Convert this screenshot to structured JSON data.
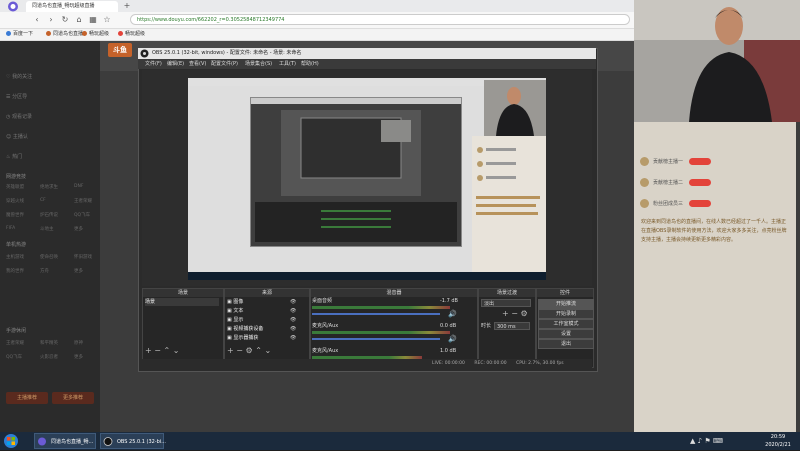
{
  "browser": {
    "tab_title": "同道鸟也直播_畅玩超级直播",
    "url": "https://www.douyu.com/662202_r=0.30525848712349774",
    "bookmarks": [
      "百度一下",
      "同道鸟也直播",
      "畅玩超级",
      "畅玩超级"
    ]
  },
  "site": {
    "logo": "斗鱼",
    "left_nav": {
      "items": [
        "我的关注",
        "分区导",
        "观看记录",
        "主播认",
        "热门"
      ],
      "sections": [
        {
          "header": "网游竞技",
          "grid": [
            "英雄联盟",
            "绝地求生",
            "DNF",
            "穿越火线",
            "CF",
            "王者荣耀",
            "魔兽世界",
            "炉石传说",
            "QQ飞车",
            "FIFA",
            "斗地主",
            "更多"
          ]
        },
        {
          "header": "单机热游",
          "grid": [
            "主机游戏",
            "使命召唤",
            "怀旧游戏",
            "我的世界",
            "方舟",
            "更多"
          ]
        },
        {
          "header": "手游休闲",
          "grid": [
            "王者荣耀",
            "和平精英",
            "原神",
            "QQ飞车",
            "火影忍者",
            "更多"
          ]
        }
      ],
      "buttons": [
        "主播推荐",
        "更多推荐"
      ]
    }
  },
  "chat": {
    "rows": [
      {
        "name": "贡献榜主播一",
        "badge": true
      },
      {
        "name": "贡献榜主播二",
        "badge": true
      },
      {
        "name": "粉丝团成员三",
        "badge": true
      }
    ],
    "message": "欢迎来到同道鸟也的直播间，在线人数已经超过了一千人。主播正在直播OBS录制软件的使用方法，欢迎大家多多关注，点亮粉丝牌支持主播，主播会持续更新更多精彩内容。"
  },
  "obs": {
    "title": "OBS 25.0.1 (32-bit, windows) - 配置文件: 未命名 - 场景: 未命名",
    "menu": [
      "文件(F)",
      "编辑(E)",
      "查看(V)",
      "配置文件(P)",
      "场景集合(S)",
      "工具(T)",
      "帮助(H)"
    ],
    "docks": {
      "scenes": {
        "title": "场景",
        "items": [
          "场景"
        ]
      },
      "sources": {
        "title": "来源",
        "items": [
          "图像",
          "文本",
          "显示",
          "视频捕获设备",
          "显示器捕获"
        ]
      },
      "mixer": {
        "title": "混音器",
        "channels": [
          {
            "label": "桌面音频",
            "value": "-1.7 dB"
          },
          {
            "label": "麦克风/Aux",
            "value": "0.0 dB"
          },
          {
            "label": "麦克风/Aux",
            "value": "1.0 dB"
          }
        ]
      },
      "transitions": {
        "title": "场景过渡",
        "type": "淡出",
        "duration_label": "时长",
        "duration": "300 ms"
      },
      "controls": {
        "title": "控件",
        "buttons": [
          "开始推流",
          "开始录制",
          "工作室模式",
          "设置",
          "退出"
        ]
      }
    },
    "status": {
      "live": "LIVE: 00:00:00",
      "rec": "REC: 00:00:00",
      "cpu": "CPU: 2.7%, 30.00 fps"
    }
  },
  "taskbar": {
    "tasks": [
      "同道鸟也直播_畅...",
      "OBS 25.0.1 (32-bi..."
    ],
    "time": "20:59",
    "date": "2020/2/21"
  },
  "colors": {
    "accent": "#c5622a",
    "badge": "#e3433a",
    "meter_green": "#3a7a3a"
  }
}
